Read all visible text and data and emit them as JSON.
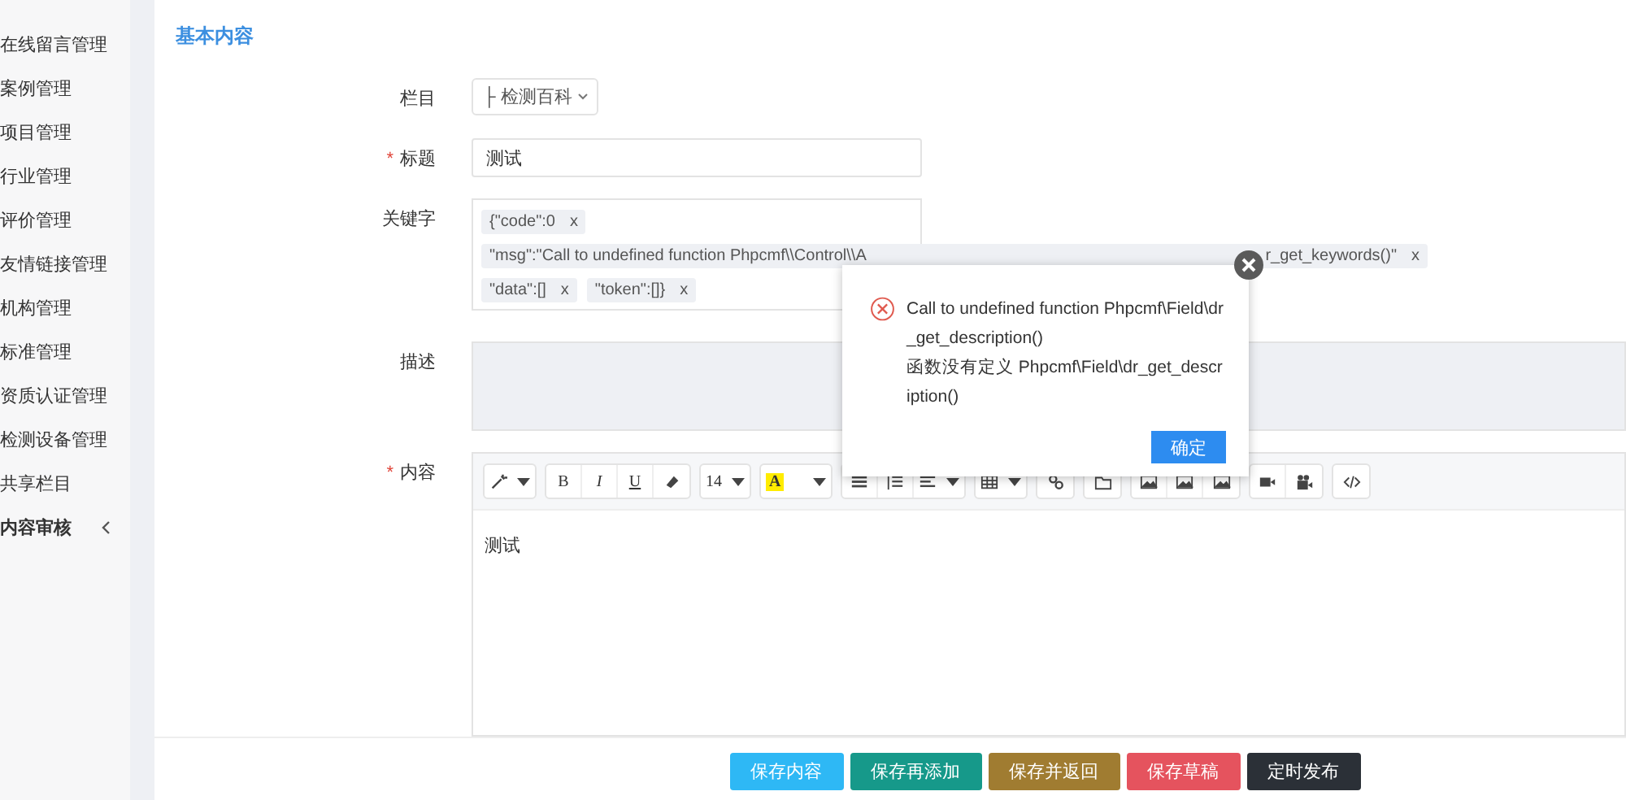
{
  "sidebar": {
    "items": [
      {
        "label": "在线留言管理",
        "expandable": false
      },
      {
        "label": "案例管理",
        "expandable": false
      },
      {
        "label": "项目管理",
        "expandable": false
      },
      {
        "label": "行业管理",
        "expandable": false
      },
      {
        "label": "评价管理",
        "expandable": false
      },
      {
        "label": "友情链接管理",
        "expandable": false
      },
      {
        "label": "机构管理",
        "expandable": false
      },
      {
        "label": "标准管理",
        "expandable": false
      },
      {
        "label": "资质认证管理",
        "expandable": false
      },
      {
        "label": "检测设备管理",
        "expandable": false
      },
      {
        "label": "共享栏目",
        "expandable": false
      },
      {
        "label": "内容审核",
        "expandable": true
      }
    ]
  },
  "section_title": "基本内容",
  "form": {
    "category": {
      "label": "栏目",
      "value": "├ 检测百科"
    },
    "title": {
      "label": "标题",
      "value": "测试",
      "marker": "*"
    },
    "keywords": {
      "label": "关键字",
      "tags": [
        {
          "text": "{\"code\":0",
          "close": "x"
        },
        {
          "text": "\"msg\":\"Call to undefined function Phpcmf\\\\Control\\\\A",
          "text_end": "r_get_keywords()\"",
          "close": "x"
        },
        {
          "text": "\"data\":[]",
          "close": "x"
        },
        {
          "text": "\"token\":[]}",
          "close": "x"
        }
      ]
    },
    "description": {
      "label": "描述"
    },
    "content": {
      "label": "内容",
      "marker": "*",
      "value": "测试",
      "toolbar": [
        [
          {
            "kind": "wand",
            "caret": true
          }
        ],
        [
          {
            "kind": "text",
            "label": "B",
            "caret": false
          },
          {
            "kind": "text",
            "label": "I",
            "caret": false
          },
          {
            "kind": "text",
            "label": "U",
            "caret": false
          },
          {
            "kind": "eraser",
            "caret": false
          }
        ],
        [
          {
            "kind": "text",
            "label": "14",
            "caret": true
          }
        ],
        [
          {
            "kind": "highlight",
            "label": "A",
            "caret": true
          }
        ],
        [
          {
            "kind": "list",
            "caret": false
          },
          {
            "kind": "olist",
            "caret": false
          },
          {
            "kind": "align",
            "caret": true
          }
        ],
        [
          {
            "kind": "table",
            "caret": true
          }
        ],
        [
          {
            "kind": "link",
            "caret": false
          }
        ],
        [
          {
            "kind": "folder",
            "caret": false
          }
        ],
        [
          {
            "kind": "image",
            "caret": false
          },
          {
            "kind": "image",
            "caret": false
          },
          {
            "kind": "image",
            "caret": false
          }
        ],
        [
          {
            "kind": "video",
            "caret": false
          },
          {
            "kind": "camera",
            "caret": false
          }
        ],
        [
          {
            "kind": "code",
            "caret": false
          }
        ]
      ]
    }
  },
  "buttons": [
    {
      "label": "保存内容",
      "color": "#2eb8f5"
    },
    {
      "label": "保存再添加",
      "color": "#16998a"
    },
    {
      "label": "保存并返回",
      "color": "#a07c31"
    },
    {
      "label": "保存草稿",
      "color": "#e5535e"
    },
    {
      "label": "定时发布",
      "color": "#2b3037"
    }
  ],
  "dialog": {
    "message": "Call to undefined function Phpcmf\\Field\\dr_get_description()",
    "detail": "函数没有定义 Phpcmf\\Field\\dr_get_description()",
    "confirm": "确定"
  }
}
